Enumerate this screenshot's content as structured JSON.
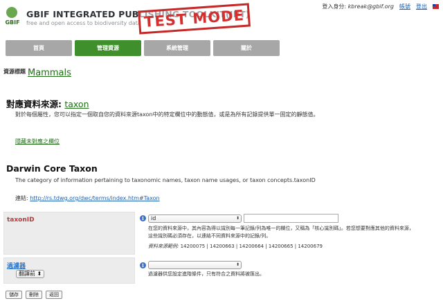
{
  "app": {
    "title": "GBIF INTEGRATED PUBLISHING TOOLKIT(IPT)",
    "subtitle": "free and open access to biodiversity data",
    "logo_text": "GBIF",
    "test_stamp": "TEST MODE"
  },
  "user_bar": {
    "logged_in_label": "登入身分",
    "user_email": "kbreak@gbif.org",
    "account_link": "帳號",
    "logout_link": "登出"
  },
  "nav": {
    "tabs": [
      {
        "label": "首頁",
        "active": false
      },
      {
        "label": "管理資源",
        "active": true
      },
      {
        "label": "系統管理",
        "active": false
      },
      {
        "label": "關於",
        "active": false
      }
    ]
  },
  "resource": {
    "label": "資源標題",
    "title": "Mammals"
  },
  "mapping": {
    "heading_prefix": "對應資料來源:",
    "source_name": "taxon",
    "description": "對於每個屬性，您可以指定一個取自您的資料來源taxon中的特定欄位中的動態值，或是為所有記錄提供單一固定的靜態值。",
    "hide_unmapped_link": "隱藏未對應之欄位"
  },
  "dwc": {
    "heading": "Darwin Core Taxon",
    "description": "The category of information pertaining to taxonomic names, taxon name usages, or taxon concepts.taxonID",
    "link_label": "連結:",
    "link_url": "http://rs.tdwg.org/dwc/terms/index.htm#Taxon"
  },
  "fields": {
    "taxon_id": {
      "name": "taxonID",
      "selected": "id",
      "help": "在您的資料來源中，其內容為得以識別每一筆記錄/列為唯一的欄位，又稱為「核心識別碼」。若您想要對應其他的資料來源，這些識別碼必須存在，以連結不同資料來源中的記錄/列。",
      "sample_label": "資料來源範例:",
      "sample_values": "14200075 | 14200663 | 14200664 | 14200665 | 14200679"
    },
    "filter": {
      "name": "過濾器",
      "translate_button": "翻譯前",
      "selected": "",
      "help": "過濾器供您設定進階條件，只有符合之資料將被匯出。"
    }
  },
  "buttons": {
    "save": "儲存",
    "delete": "刪除",
    "back": "返回"
  }
}
